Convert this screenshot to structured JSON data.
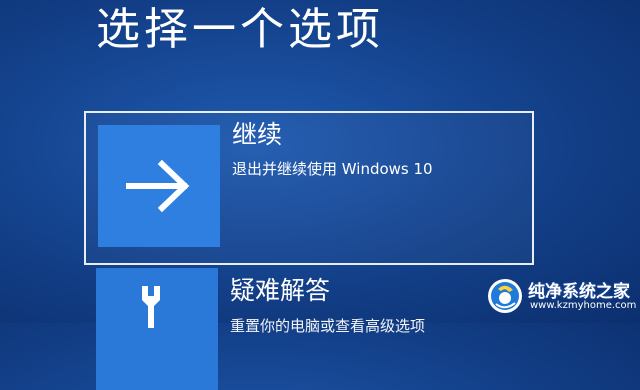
{
  "screen": {
    "title": "选择一个选项"
  },
  "options": [
    {
      "title": "继续",
      "description": "退出并继续使用 Windows 10",
      "icon": "arrow-right-icon"
    },
    {
      "title": "疑难解答",
      "description": "重置你的电脑或查看高级选项",
      "icon": "tools-icon"
    }
  ],
  "watermark": {
    "name": "纯净系统之家",
    "url": "www.kzmyhome.com"
  },
  "colors": {
    "background": "#134089",
    "tile": "#2f7fe0",
    "text": "#ffffff"
  }
}
